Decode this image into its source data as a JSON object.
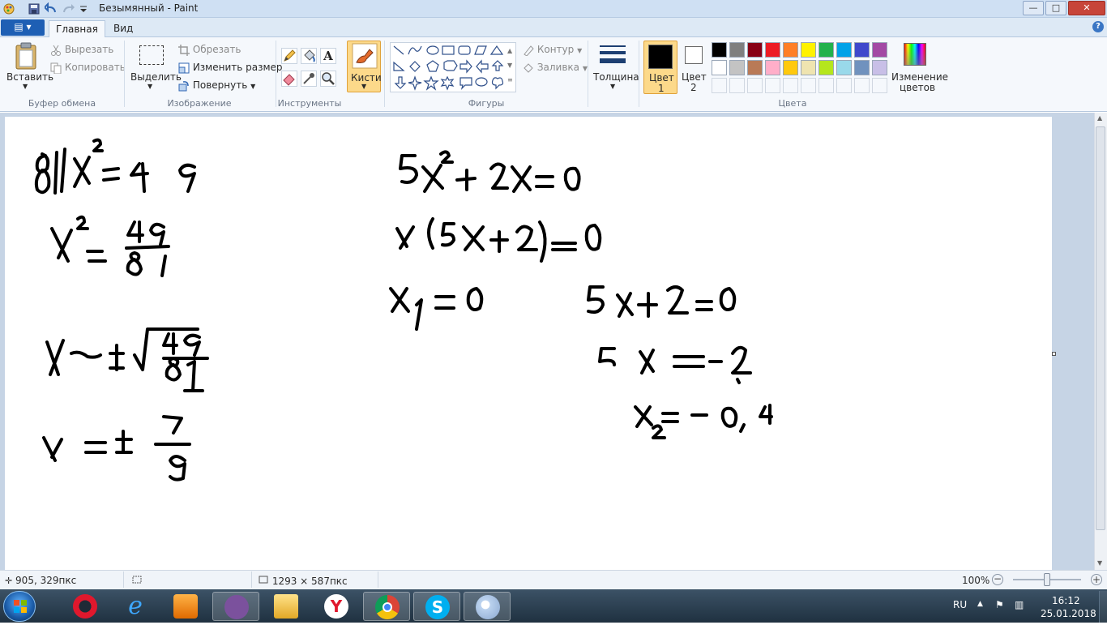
{
  "window": {
    "title": "Безымянный - Paint",
    "controls": {
      "minimize": "—",
      "maximize": "□",
      "close": "✕"
    }
  },
  "tabs": {
    "file": "▤ ▾",
    "home": "Главная",
    "view": "Вид",
    "help": "?"
  },
  "clipboard": {
    "paste": "Вставить",
    "cut": "Вырезать",
    "copy": "Копировать",
    "group": "Буфер обмена"
  },
  "image": {
    "select": "Выделить",
    "crop": "Обрезать",
    "resize": "Изменить размер",
    "rotate": "Повернуть",
    "group": "Изображение"
  },
  "tools": {
    "group": "Инструменты",
    "text_glyph": "A"
  },
  "brushes": {
    "label": "Кисти"
  },
  "shapes": {
    "outline": "Контур",
    "fill": "Заливка",
    "group": "Фигуры"
  },
  "size": {
    "label": "Толщина"
  },
  "colors": {
    "color1_a": "Цвет",
    "color1_b": "1",
    "color2_a": "Цвет",
    "color2_b": "2",
    "edit_a": "Изменение",
    "edit_b": "цветов",
    "group": "Цвета",
    "color1": "#000000",
    "color2": "#ffffff",
    "row1": [
      "#000000",
      "#7f7f7f",
      "#880015",
      "#ed1c24",
      "#ff7f27",
      "#fff200",
      "#22b14c",
      "#00a2e8",
      "#3f48cc",
      "#a349a4"
    ],
    "row2": [
      "#ffffff",
      "#c3c3c3",
      "#b97a57",
      "#ffaec9",
      "#ffc90e",
      "#efe4b0",
      "#b5e61d",
      "#99d9ea",
      "#7092be",
      "#c8bfe7"
    ]
  },
  "status": {
    "cursor": "905, 329пкс",
    "image_size": "1293 × 587пкс",
    "zoom": "100%",
    "zoom_minus": "−",
    "zoom_plus": "+"
  },
  "taskbar": {
    "lang": "RU",
    "time": "16:12",
    "date": "25.01.2018"
  }
}
